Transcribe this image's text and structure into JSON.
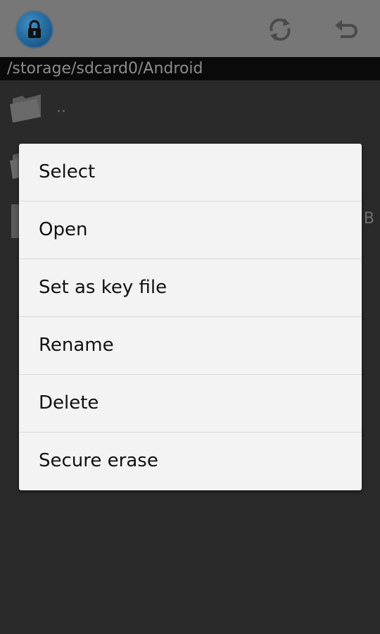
{
  "action_bar": {
    "icons": [
      "lock-icon",
      "refresh-icon",
      "undo-icon"
    ]
  },
  "path": "/storage/sdcard0/Android",
  "file_list": [
    {
      "name": "..",
      "icon": "folder-icon"
    },
    {
      "name": "",
      "icon": "folder-icon"
    },
    {
      "name": "",
      "size": "B",
      "icon": "file-icon"
    }
  ],
  "context_menu": {
    "items": [
      {
        "label": "Select"
      },
      {
        "label": "Open"
      },
      {
        "label": "Set as key file"
      },
      {
        "label": "Rename"
      },
      {
        "label": "Delete"
      },
      {
        "label": "Secure erase"
      }
    ]
  },
  "colors": {
    "action_bar": "#777777",
    "background": "#2a2a2a",
    "path_bar": "#0a0a0a",
    "menu_background": "#f3f3f3",
    "menu_text": "#111111",
    "app_icon_blue": "#1f5f93"
  }
}
